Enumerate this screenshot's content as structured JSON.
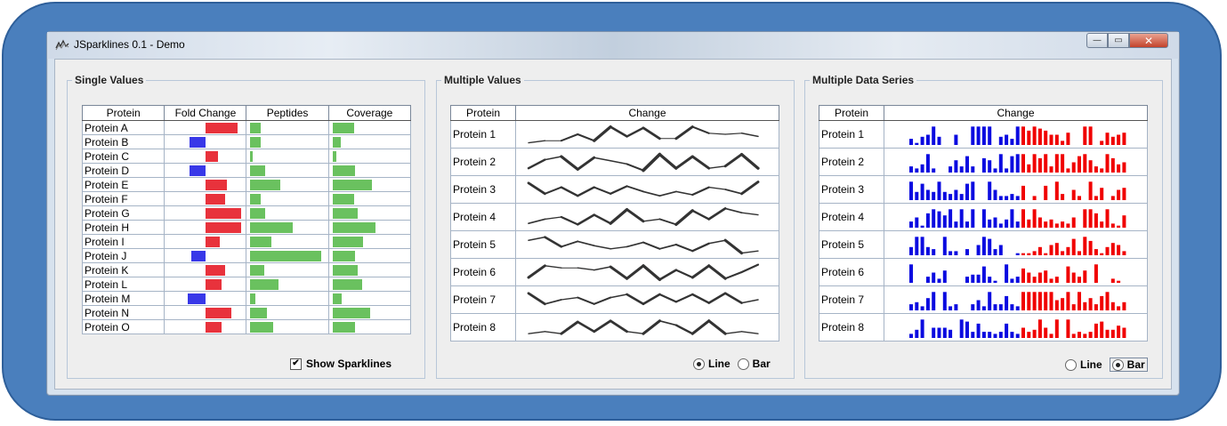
{
  "window": {
    "title": "JSparklines 0.1 - Demo",
    "minimize": "—",
    "maximize": "▭",
    "close": "✕"
  },
  "colors": {
    "positive": "#e8323c",
    "negative": "#3838e8",
    "green": "#6ac15f",
    "line": "#333333",
    "blue": "#0b0be0",
    "red": "#f00000"
  },
  "panels": {
    "single": {
      "title": "Single Values",
      "headers": [
        "Protein",
        "Fold Change",
        "Peptides",
        "Coverage"
      ],
      "show_sparklines_label": "Show Sparklines",
      "show_sparklines_checked": true,
      "rows": [
        {
          "name": "Protein A",
          "fold": 0.9,
          "peptides": 0.15,
          "coverage": 0.3
        },
        {
          "name": "Protein B",
          "fold": -0.45,
          "peptides": 0.15,
          "coverage": 0.12
        },
        {
          "name": "Protein C",
          "fold": 0.35,
          "peptides": 0.03,
          "coverage": 0.05
        },
        {
          "name": "Protein D",
          "fold": -0.45,
          "peptides": 0.21,
          "coverage": 0.32
        },
        {
          "name": "Protein E",
          "fold": 0.6,
          "peptides": 0.42,
          "coverage": 0.55
        },
        {
          "name": "Protein F",
          "fold": 0.55,
          "peptides": 0.15,
          "coverage": 0.3
        },
        {
          "name": "Protein G",
          "fold": 1.0,
          "peptides": 0.21,
          "coverage": 0.35
        },
        {
          "name": "Protein H",
          "fold": 1.0,
          "peptides": 0.6,
          "coverage": 0.6
        },
        {
          "name": "Protein I",
          "fold": 0.38,
          "peptides": 0.3,
          "coverage": 0.43
        },
        {
          "name": "Protein J",
          "fold": -0.4,
          "peptides": 1.0,
          "coverage": 0.32
        },
        {
          "name": "Protein K",
          "fold": 0.55,
          "peptides": 0.2,
          "coverage": 0.36
        },
        {
          "name": "Protein L",
          "fold": 0.45,
          "peptides": 0.4,
          "coverage": 0.42
        },
        {
          "name": "Protein M",
          "fold": -0.5,
          "peptides": 0.07,
          "coverage": 0.13
        },
        {
          "name": "Protein N",
          "fold": 0.72,
          "peptides": 0.23,
          "coverage": 0.53
        },
        {
          "name": "Protein O",
          "fold": 0.45,
          "peptides": 0.32,
          "coverage": 0.32
        }
      ]
    },
    "multi_values": {
      "title": "Multiple Values",
      "headers": [
        "Protein",
        "Change"
      ],
      "radio_line": "Line",
      "radio_bar": "Bar",
      "selected": "Line",
      "rows": [
        {
          "name": "Protein 1",
          "values": [
            0.1,
            0.2,
            0.2,
            0.5,
            0.2,
            0.85,
            0.4,
            0.8,
            0.3,
            0.3,
            0.85,
            0.55,
            0.5,
            0.55,
            0.4
          ]
        },
        {
          "name": "Protein 2",
          "values": [
            0.2,
            0.6,
            0.75,
            0.15,
            0.7,
            0.55,
            0.4,
            0.1,
            0.85,
            0.2,
            0.75,
            0.2,
            0.3,
            0.85,
            0.2
          ]
        },
        {
          "name": "Protein 3",
          "values": [
            0.8,
            0.3,
            0.6,
            0.2,
            0.6,
            0.3,
            0.65,
            0.4,
            0.2,
            0.4,
            0.25,
            0.6,
            0.5,
            0.3,
            0.85
          ]
        },
        {
          "name": "Protein 4",
          "values": [
            0.2,
            0.4,
            0.5,
            0.15,
            0.6,
            0.2,
            0.85,
            0.3,
            0.4,
            0.15,
            0.8,
            0.4,
            0.9,
            0.7,
            0.6
          ]
        },
        {
          "name": "Protein 5",
          "values": [
            0.7,
            0.85,
            0.4,
            0.65,
            0.45,
            0.3,
            0.4,
            0.6,
            0.3,
            0.5,
            0.2,
            0.55,
            0.7,
            0.1,
            0.2
          ]
        },
        {
          "name": "Protein 6",
          "values": [
            0.25,
            0.8,
            0.7,
            0.7,
            0.6,
            0.75,
            0.2,
            0.8,
            0.15,
            0.6,
            0.25,
            0.8,
            0.2,
            0.5,
            0.85
          ]
        },
        {
          "name": "Protein 7",
          "values": [
            0.8,
            0.3,
            0.5,
            0.6,
            0.3,
            0.6,
            0.75,
            0.3,
            0.75,
            0.4,
            0.75,
            0.35,
            0.8,
            0.35,
            0.5
          ]
        },
        {
          "name": "Protein 8",
          "values": [
            0.2,
            0.3,
            0.2,
            0.75,
            0.3,
            0.8,
            0.3,
            0.2,
            0.8,
            0.6,
            0.2,
            0.8,
            0.2,
            0.3,
            0.2
          ]
        }
      ]
    },
    "multi_series": {
      "title": "Multiple Data Series",
      "headers": [
        "Protein",
        "Change"
      ],
      "radio_line": "Line",
      "radio_bar": "Bar",
      "selected": "Bar",
      "rows": [
        {
          "name": "Protein 1",
          "blue": [
            0.3,
            0.1,
            0.4,
            0.5,
            0.9,
            0.4,
            0,
            0,
            0.5,
            0,
            0,
            0.9,
            0.9,
            0.9,
            0.9,
            0,
            0.4,
            0.5,
            0.3,
            0.9
          ],
          "red": [
            0.9,
            0.7,
            0.9,
            0.8,
            0.7,
            0.5,
            0.5,
            0.2,
            0.6,
            0,
            0,
            0.9,
            0.9,
            0,
            0.2,
            0.6,
            0.4,
            0.5,
            0.6
          ]
        },
        {
          "name": "Protein 2",
          "blue": [
            0.3,
            0.2,
            0.4,
            0.9,
            0.2,
            0,
            0,
            0.3,
            0.6,
            0.3,
            0.8,
            0.3,
            0,
            0.7,
            0.6,
            0.2,
            0.9,
            0.2,
            0.8,
            0.9
          ],
          "red": [
            0.9,
            0.4,
            0.9,
            0.7,
            0.9,
            0.3,
            0.9,
            0.9,
            0.2,
            0.5,
            0.8,
            0.9,
            0.6,
            0.3,
            0.2,
            0.9,
            0.7,
            0.4,
            0.5
          ]
        },
        {
          "name": "Protein 3",
          "blue": [
            0.9,
            0.4,
            0.8,
            0.5,
            0.4,
            0.9,
            0.4,
            0.3,
            0.5,
            0.3,
            0.8,
            0.9,
            0,
            0,
            0.9,
            0.5,
            0.2,
            0.2,
            0.3,
            0.2
          ],
          "red": [
            0.7,
            0,
            0.2,
            0,
            0.7,
            0,
            0.9,
            0.3,
            0,
            0.5,
            0.2,
            0,
            0.9,
            0.2,
            0.6,
            0,
            0.2,
            0.5,
            0.6
          ]
        },
        {
          "name": "Protein 4",
          "blue": [
            0.3,
            0.5,
            0.1,
            0.7,
            0.9,
            0.8,
            0.6,
            0.9,
            0.3,
            0.9,
            0.3,
            0.9,
            0,
            0.9,
            0.4,
            0.5,
            0.2,
            0.4,
            0.9,
            0.3
          ],
          "red": [
            0.9,
            0.4,
            0.9,
            0.5,
            0.3,
            0.4,
            0.2,
            0.3,
            0.2,
            0.5,
            0,
            0.9,
            0.9,
            0.7,
            0.3,
            0.9,
            0.2,
            0.1,
            0.6
          ]
        },
        {
          "name": "Protein 5",
          "blue": [
            0.4,
            0.9,
            0.9,
            0.4,
            0.3,
            0,
            0.9,
            0.2,
            0.2,
            0,
            0.3,
            0,
            0.5,
            0.9,
            0.8,
            0.3,
            0.5,
            0,
            0,
            0.1
          ],
          "red": [
            0.1,
            0.1,
            0.2,
            0.4,
            0.1,
            0.5,
            0.6,
            0.2,
            0.4,
            0.8,
            0.2,
            0.9,
            0.7,
            0.3,
            0.1,
            0.4,
            0.6,
            0.5,
            0.2
          ]
        },
        {
          "name": "Protein 6",
          "blue": [
            0.9,
            0,
            0,
            0.3,
            0.5,
            0.2,
            0.6,
            0,
            0,
            0,
            0.3,
            0.4,
            0.4,
            0.8,
            0.3,
            0.1,
            0,
            0.9,
            0.2,
            0.3
          ],
          "red": [
            0.7,
            0.5,
            0.3,
            0.5,
            0.6,
            0.2,
            0.3,
            0,
            0.8,
            0.5,
            0.3,
            0.6,
            0,
            0.9,
            0,
            0,
            0.2,
            0.1,
            0
          ]
        },
        {
          "name": "Protein 7",
          "blue": [
            0.3,
            0.4,
            0.2,
            0.6,
            0.9,
            0,
            0.9,
            0.2,
            0.3,
            0,
            0,
            0.3,
            0.5,
            0.2,
            0.9,
            0.3,
            0.3,
            0.7,
            0.3,
            0.2
          ],
          "red": [
            0.9,
            0.9,
            0.9,
            0.9,
            0.9,
            0.9,
            0.5,
            0.6,
            0.9,
            0.3,
            0.9,
            0.4,
            0.6,
            0.3,
            0.7,
            0.9,
            0.4,
            0.2,
            0.4
          ]
        },
        {
          "name": "Protein 8",
          "blue": [
            0.2,
            0.4,
            0.9,
            0,
            0.5,
            0.5,
            0.5,
            0.4,
            0,
            0.9,
            0.8,
            0.3,
            0.7,
            0.3,
            0.3,
            0.2,
            0.3,
            0.7,
            0.3,
            0.2
          ],
          "red": [
            0.5,
            0.3,
            0.4,
            0.9,
            0.5,
            0.2,
            0.9,
            0,
            0.9,
            0.2,
            0.3,
            0.2,
            0.3,
            0.7,
            0.8,
            0.4,
            0.4,
            0.6,
            0.5
          ]
        }
      ]
    }
  }
}
